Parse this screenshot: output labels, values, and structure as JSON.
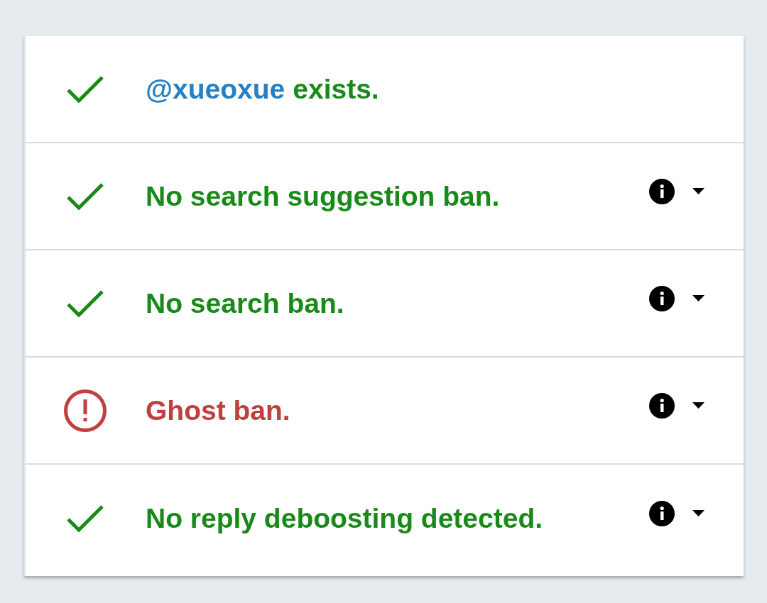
{
  "checks": [
    {
      "kind": "pass",
      "handle": "@xueoxue",
      "text": "exists.",
      "expandable": false
    },
    {
      "kind": "pass",
      "text": "No search suggestion ban.",
      "expandable": true
    },
    {
      "kind": "pass",
      "text": "No search ban.",
      "expandable": true
    },
    {
      "kind": "fail",
      "text": "Ghost ban.",
      "expandable": true
    },
    {
      "kind": "pass",
      "text": "No reply deboosting detected.",
      "expandable": true
    }
  ]
}
